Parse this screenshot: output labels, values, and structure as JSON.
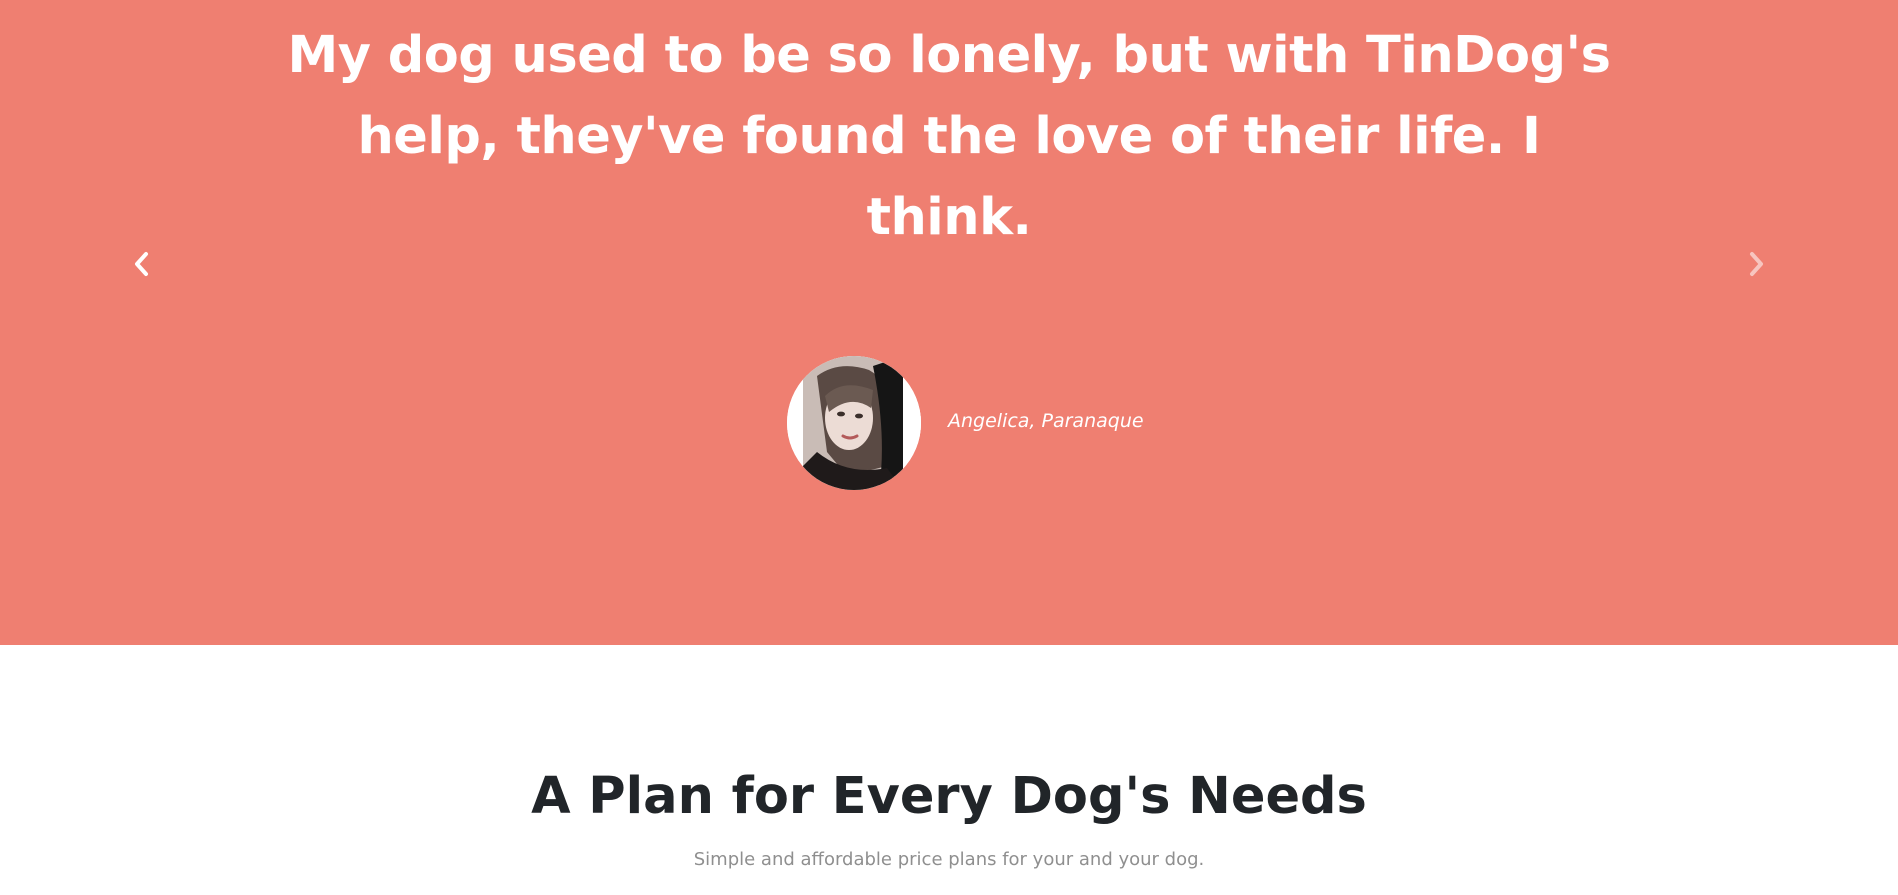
{
  "testimonial": {
    "quote": "My dog used to be so lonely, but with TinDog's help, they've found the love of their life. I think.",
    "author": "Angelica, Paranaque",
    "avatar_icon": "profile-photo",
    "prev_icon": "chevron-left-icon",
    "next_icon": "chevron-right-icon",
    "background_color": "#ef7f71"
  },
  "pricing": {
    "title": "A Plan for Every Dog's Needs",
    "subtitle": "Simple and affordable price plans for your and your dog."
  }
}
